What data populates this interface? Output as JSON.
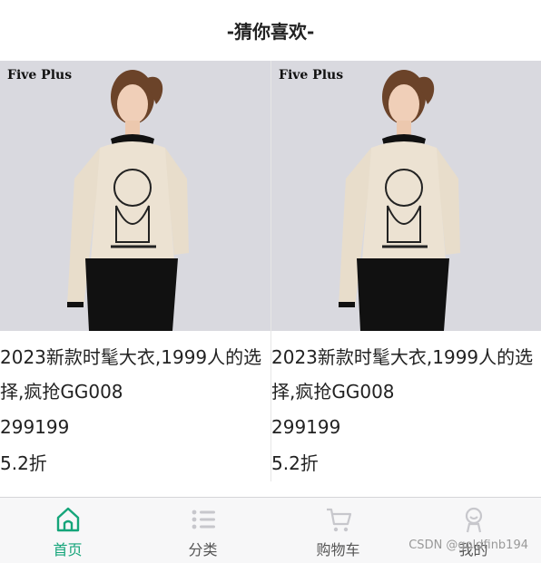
{
  "header": {
    "title": "-猜你喜欢-"
  },
  "products": [
    {
      "brand": "Five Plus",
      "title": "2023新款时髦大衣,1999人的选择,疯抢GG008",
      "price": "299199",
      "discount": "5.2折"
    },
    {
      "brand": "Five Plus",
      "title": "2023新款时髦大衣,1999人的选择,疯抢GG008",
      "price": "299199",
      "discount": "5.2折"
    }
  ],
  "tabbar": {
    "items": [
      {
        "label": "首页",
        "icon": "home-icon",
        "active": true
      },
      {
        "label": "分类",
        "icon": "list-icon",
        "active": false
      },
      {
        "label": "购物车",
        "icon": "cart-icon",
        "active": false
      },
      {
        "label": "我的",
        "icon": "user-icon",
        "active": false
      }
    ]
  },
  "watermark": "CSDN @goldfinb194",
  "colors": {
    "accent": "#15a57a",
    "tab_bg": "#f7f7f8",
    "image_bg": "#d9d9df"
  }
}
